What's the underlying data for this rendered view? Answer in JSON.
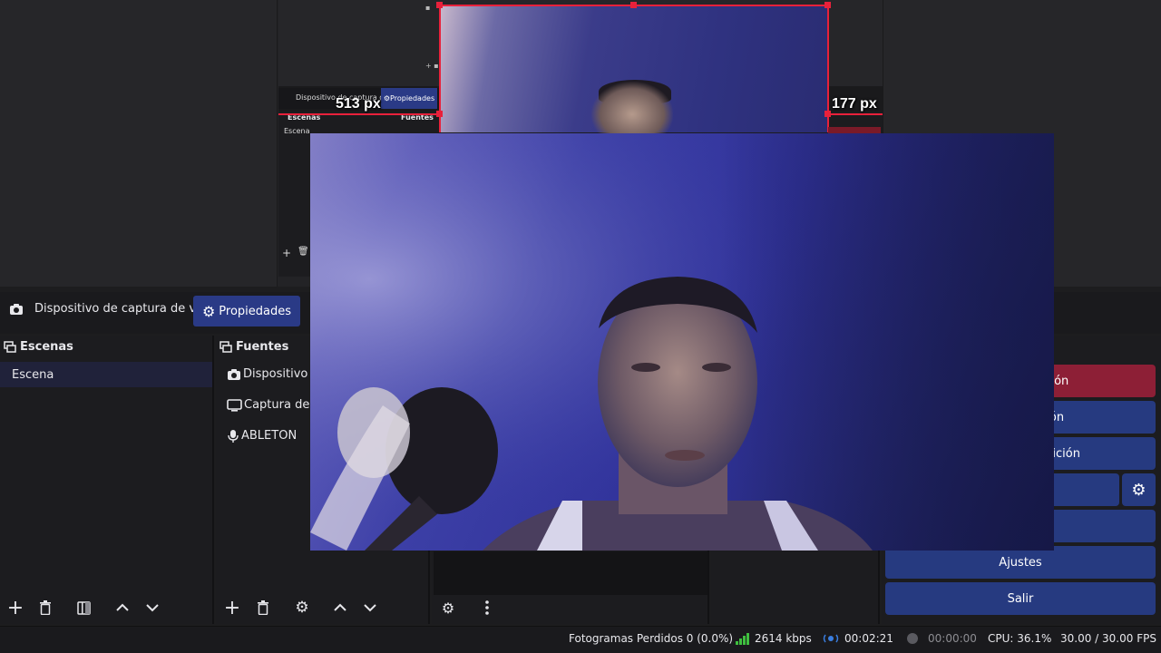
{
  "preview": {
    "measure_left": "513 px",
    "measure_right": "177 px",
    "mini": {
      "source_label": "Dispositivo de captura de vid",
      "properties_label": "Propiedades",
      "scenes_title": "Escenas",
      "sources_title": "Fuentes",
      "scene_item": "Escena"
    }
  },
  "toolbar": {
    "source_name": "Dispositivo de captura de vid",
    "properties_label": "Propiedades"
  },
  "scenes": {
    "title": "Escenas",
    "items": [
      {
        "label": "Escena"
      }
    ]
  },
  "sources": {
    "title": "Fuentes",
    "items": [
      {
        "label": "Dispositivo d",
        "icon": "camera-icon"
      },
      {
        "label": "Captura de p",
        "icon": "monitor-icon"
      },
      {
        "label": "ABLETON",
        "icon": "microphone-icon"
      }
    ]
  },
  "controls": {
    "stream_label": "sión",
    "record_label": "ón",
    "replay_label": "petición",
    "virtualcam_label": "l",
    "studio_label": "",
    "settings_label": "Ajustes",
    "exit_label": "Salir"
  },
  "status": {
    "dropped_frames": "Fotogramas Perdidos 0 (0.0%)",
    "bitrate": "2614 kbps",
    "stream_time": "00:02:21",
    "record_time": "00:00:00",
    "cpu": "CPU: 36.1%",
    "fps": "30.00 / 30.00 FPS"
  },
  "colors": {
    "accent_blue": "#263a80",
    "stream_red": "#8d1f36",
    "selection_red": "#e8213b",
    "bitrate_green": "#3fbf3f"
  }
}
